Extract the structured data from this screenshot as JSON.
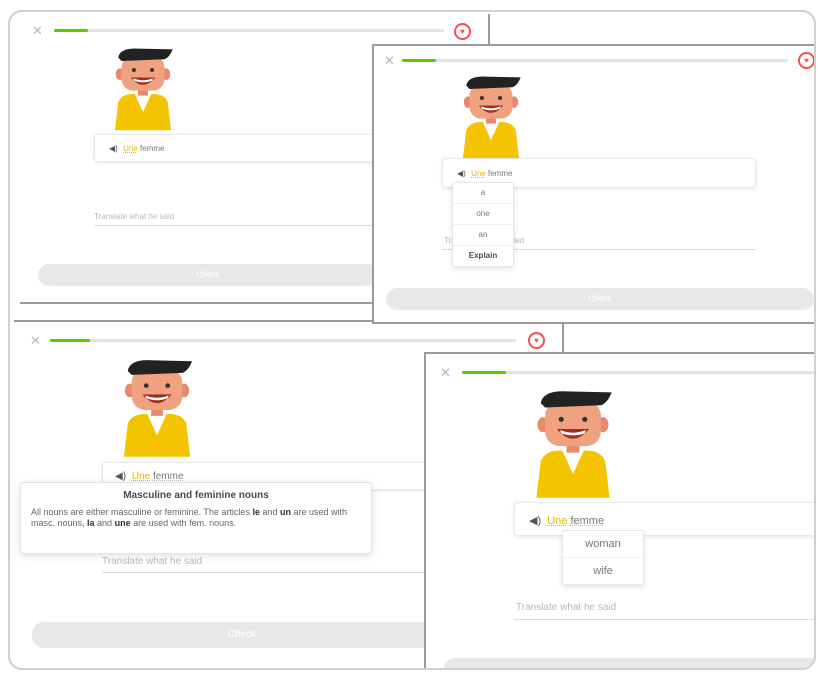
{
  "lesson": {
    "sentence_article": "Une",
    "sentence_noun": "femme",
    "translate_placeholder": "Translate what he said",
    "check_label": "Check"
  },
  "article_menu": {
    "options": [
      "a",
      "one",
      "an",
      "Explain"
    ]
  },
  "noun_menu": {
    "options": [
      "woman",
      "wife"
    ]
  },
  "grammar_tip": {
    "title": "Masculine and feminine nouns",
    "body_1": "All nouns are either masculine or feminine. The articles ",
    "word_le": "le",
    "body_2": " and ",
    "word_un": "un",
    "body_3": " are used with masc. nouns, ",
    "word_la": "la",
    "body_4": " and ",
    "word_une": "une",
    "body_5": " are used with fem. nouns."
  },
  "colors": {
    "progress": "#58cc02",
    "heart": "#ff4b4b",
    "highlight": "#e9b600",
    "shirt": "#f5c400"
  },
  "icons": {
    "close": "close-icon",
    "heart": "heart-icon",
    "speaker": "speaker-icon"
  }
}
